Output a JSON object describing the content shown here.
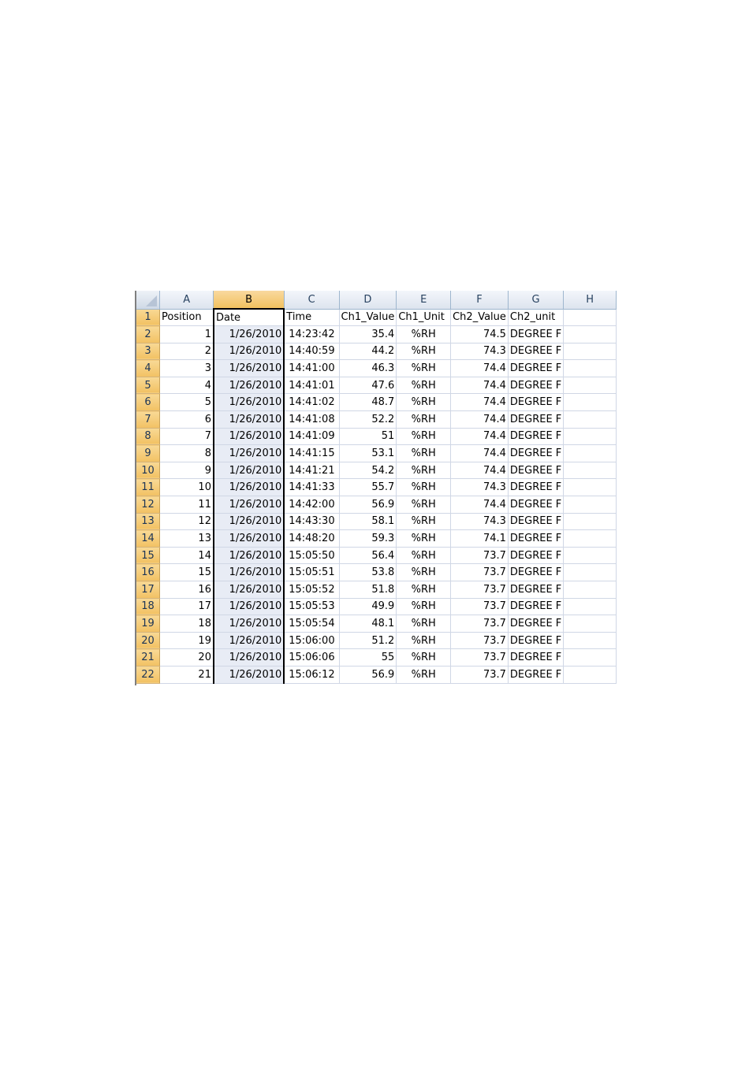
{
  "spreadsheet": {
    "columns": [
      "A",
      "B",
      "C",
      "D",
      "E",
      "F",
      "G",
      "H"
    ],
    "selected_column": "B",
    "header_row": {
      "row_number": "1",
      "cells": [
        "Position",
        "Date",
        "Time",
        "Ch1_Value",
        "Ch1_Unit",
        "Ch2_Value",
        "Ch2_unit",
        ""
      ]
    },
    "rows": [
      {
        "row_number": "2",
        "position": "1",
        "date": "1/26/2010",
        "time": "14:23:42",
        "ch1_value": "35.4",
        "ch1_unit": "%RH",
        "ch2_value": "74.5",
        "ch2_unit": "DEGREE F"
      },
      {
        "row_number": "3",
        "position": "2",
        "date": "1/26/2010",
        "time": "14:40:59",
        "ch1_value": "44.2",
        "ch1_unit": "%RH",
        "ch2_value": "74.3",
        "ch2_unit": "DEGREE F"
      },
      {
        "row_number": "4",
        "position": "3",
        "date": "1/26/2010",
        "time": "14:41:00",
        "ch1_value": "46.3",
        "ch1_unit": "%RH",
        "ch2_value": "74.4",
        "ch2_unit": "DEGREE F"
      },
      {
        "row_number": "5",
        "position": "4",
        "date": "1/26/2010",
        "time": "14:41:01",
        "ch1_value": "47.6",
        "ch1_unit": "%RH",
        "ch2_value": "74.4",
        "ch2_unit": "DEGREE F"
      },
      {
        "row_number": "6",
        "position": "5",
        "date": "1/26/2010",
        "time": "14:41:02",
        "ch1_value": "48.7",
        "ch1_unit": "%RH",
        "ch2_value": "74.4",
        "ch2_unit": "DEGREE F"
      },
      {
        "row_number": "7",
        "position": "6",
        "date": "1/26/2010",
        "time": "14:41:08",
        "ch1_value": "52.2",
        "ch1_unit": "%RH",
        "ch2_value": "74.4",
        "ch2_unit": "DEGREE F"
      },
      {
        "row_number": "8",
        "position": "7",
        "date": "1/26/2010",
        "time": "14:41:09",
        "ch1_value": "51",
        "ch1_unit": "%RH",
        "ch2_value": "74.4",
        "ch2_unit": "DEGREE F"
      },
      {
        "row_number": "9",
        "position": "8",
        "date": "1/26/2010",
        "time": "14:41:15",
        "ch1_value": "53.1",
        "ch1_unit": "%RH",
        "ch2_value": "74.4",
        "ch2_unit": "DEGREE F"
      },
      {
        "row_number": "10",
        "position": "9",
        "date": "1/26/2010",
        "time": "14:41:21",
        "ch1_value": "54.2",
        "ch1_unit": "%RH",
        "ch2_value": "74.4",
        "ch2_unit": "DEGREE F"
      },
      {
        "row_number": "11",
        "position": "10",
        "date": "1/26/2010",
        "time": "14:41:33",
        "ch1_value": "55.7",
        "ch1_unit": "%RH",
        "ch2_value": "74.3",
        "ch2_unit": "DEGREE F"
      },
      {
        "row_number": "12",
        "position": "11",
        "date": "1/26/2010",
        "time": "14:42:00",
        "ch1_value": "56.9",
        "ch1_unit": "%RH",
        "ch2_value": "74.4",
        "ch2_unit": "DEGREE F"
      },
      {
        "row_number": "13",
        "position": "12",
        "date": "1/26/2010",
        "time": "14:43:30",
        "ch1_value": "58.1",
        "ch1_unit": "%RH",
        "ch2_value": "74.3",
        "ch2_unit": "DEGREE F"
      },
      {
        "row_number": "14",
        "position": "13",
        "date": "1/26/2010",
        "time": "14:48:20",
        "ch1_value": "59.3",
        "ch1_unit": "%RH",
        "ch2_value": "74.1",
        "ch2_unit": "DEGREE F"
      },
      {
        "row_number": "15",
        "position": "14",
        "date": "1/26/2010",
        "time": "15:05:50",
        "ch1_value": "56.4",
        "ch1_unit": "%RH",
        "ch2_value": "73.7",
        "ch2_unit": "DEGREE F"
      },
      {
        "row_number": "16",
        "position": "15",
        "date": "1/26/2010",
        "time": "15:05:51",
        "ch1_value": "53.8",
        "ch1_unit": "%RH",
        "ch2_value": "73.7",
        "ch2_unit": "DEGREE F"
      },
      {
        "row_number": "17",
        "position": "16",
        "date": "1/26/2010",
        "time": "15:05:52",
        "ch1_value": "51.8",
        "ch1_unit": "%RH",
        "ch2_value": "73.7",
        "ch2_unit": "DEGREE F"
      },
      {
        "row_number": "18",
        "position": "17",
        "date": "1/26/2010",
        "time": "15:05:53",
        "ch1_value": "49.9",
        "ch1_unit": "%RH",
        "ch2_value": "73.7",
        "ch2_unit": "DEGREE F"
      },
      {
        "row_number": "19",
        "position": "18",
        "date": "1/26/2010",
        "time": "15:05:54",
        "ch1_value": "48.1",
        "ch1_unit": "%RH",
        "ch2_value": "73.7",
        "ch2_unit": "DEGREE F"
      },
      {
        "row_number": "20",
        "position": "19",
        "date": "1/26/2010",
        "time": "15:06:00",
        "ch1_value": "51.2",
        "ch1_unit": "%RH",
        "ch2_value": "73.7",
        "ch2_unit": "DEGREE F"
      },
      {
        "row_number": "21",
        "position": "20",
        "date": "1/26/2010",
        "time": "15:06:06",
        "ch1_value": "55",
        "ch1_unit": "%RH",
        "ch2_value": "73.7",
        "ch2_unit": "DEGREE F"
      },
      {
        "row_number": "22",
        "position": "21",
        "date": "1/26/2010",
        "time": "15:06:12",
        "ch1_value": "56.9",
        "ch1_unit": "%RH",
        "ch2_value": "73.7",
        "ch2_unit": "DEGREE F"
      }
    ],
    "colors": {
      "row_header_bg": "#f5cd7d",
      "selected_column_header_bg": "#f5cd7d",
      "selected_column_bg": "#e8ecf5",
      "gridline": "#d0d7e5"
    }
  }
}
